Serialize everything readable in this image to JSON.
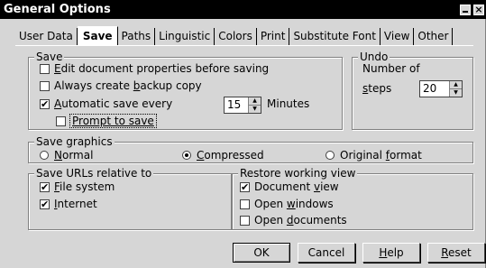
{
  "window": {
    "title": "General Options"
  },
  "tabs": [
    "User Data",
    "Save",
    "Paths",
    "Linguistic",
    "Colors",
    "Print",
    "Substitute Font",
    "View",
    "Other"
  ],
  "save": {
    "title": "Save",
    "edit_props": {
      "pre": "",
      "acc": "E",
      "post": "dit document properties before saving",
      "checked": false
    },
    "backup": {
      "pre": "Always create ",
      "acc": "b",
      "post": "ackup copy",
      "checked": false
    },
    "autosave": {
      "pre": "",
      "acc": "A",
      "post": "utomatic save every",
      "checked": true,
      "value": "15",
      "unit": "Minutes"
    },
    "prompt": {
      "label": "Prompt to save",
      "checked": false
    }
  },
  "undo": {
    "title": "Undo",
    "label_line1": "Number of",
    "label_line2_acc": "s",
    "label_line2_post": "teps",
    "value": "20"
  },
  "save_graphics": {
    "title": "Save graphics",
    "normal": {
      "acc": "N",
      "post": "ormal",
      "selected": false
    },
    "compressed": {
      "acc": "C",
      "post": "ompressed",
      "selected": true
    },
    "original": {
      "pre": "Original ",
      "acc": "f",
      "post": "ormat",
      "selected": false
    }
  },
  "save_urls": {
    "title": "Save URLs relative to",
    "file_system": {
      "acc": "F",
      "post": "ile system",
      "checked": true
    },
    "internet": {
      "acc": "I",
      "post": "nternet",
      "checked": true
    }
  },
  "restore": {
    "title": "Restore working view",
    "doc_view": {
      "pre": "Document ",
      "acc": "v",
      "post": "iew",
      "checked": true
    },
    "open_windows": {
      "pre": "Open ",
      "acc": "w",
      "post": "indows",
      "checked": false
    },
    "open_documents": {
      "pre": "Open ",
      "acc": "d",
      "post": "ocuments",
      "checked": false
    }
  },
  "buttons": {
    "ok": "OK",
    "cancel": "Cancel",
    "help": {
      "acc": "H",
      "post": "elp"
    },
    "reset": {
      "acc": "R",
      "post": "eset"
    }
  },
  "icons": {
    "minimize": "minimize-icon",
    "close": "close-icon",
    "check": "✔",
    "spin_up": "▲",
    "spin_down": "▼"
  }
}
